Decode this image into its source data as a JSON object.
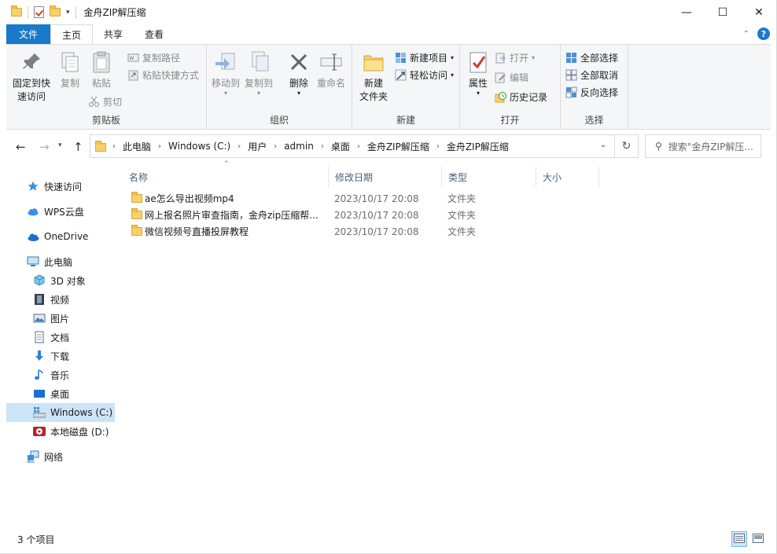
{
  "window": {
    "title": "金舟ZIP解压缩"
  },
  "window_controls": {
    "minimize": "—",
    "maximize": "☐",
    "close": "✕"
  },
  "ribbon_tabs": [
    {
      "label": "文件"
    },
    {
      "label": "主页"
    },
    {
      "label": "共享"
    },
    {
      "label": "查看"
    }
  ],
  "ribbon": {
    "clipboard": {
      "pin_line1": "固定到快",
      "pin_line2": "速访问",
      "copy": "复制",
      "paste": "粘贴",
      "copy_path": "复制路径",
      "paste_shortcut": "粘贴快捷方式",
      "cut": "剪切",
      "label": "剪贴板"
    },
    "organize": {
      "move_to": "移动到",
      "copy_to": "复制到",
      "delete": "删除",
      "rename": "重命名",
      "label": "组织"
    },
    "new": {
      "new_folder_line1": "新建",
      "new_folder_line2": "文件夹",
      "new_item": "新建项目",
      "easy_access": "轻松访问",
      "label": "新建"
    },
    "open": {
      "properties": "属性",
      "open": "打开",
      "edit": "编辑",
      "history": "历史记录",
      "label": "打开"
    },
    "select": {
      "select_all": "全部选择",
      "select_none": "全部取消",
      "invert": "反向选择",
      "label": "选择"
    }
  },
  "address": {
    "breadcrumbs": [
      "此电脑",
      "Windows (C:)",
      "用户",
      "admin",
      "桌面",
      "金舟ZIP解压缩",
      "金舟ZIP解压缩"
    ],
    "search_placeholder": "搜索\"金舟ZIP解压..."
  },
  "nav_pane": [
    {
      "label": "快速访问"
    },
    {
      "label": "WPS云盘"
    },
    {
      "label": "OneDrive"
    },
    {
      "label": "此电脑"
    },
    {
      "label": "3D 对象"
    },
    {
      "label": "视频"
    },
    {
      "label": "图片"
    },
    {
      "label": "文档"
    },
    {
      "label": "下载"
    },
    {
      "label": "音乐"
    },
    {
      "label": "桌面"
    },
    {
      "label": "Windows (C:)"
    },
    {
      "label": "本地磁盘 (D:)"
    },
    {
      "label": "网络"
    }
  ],
  "columns": {
    "name": "名称",
    "date": "修改日期",
    "type": "类型",
    "size": "大小"
  },
  "files": [
    {
      "name": "ae怎么导出视频mp4",
      "date": "2023/10/17 20:08",
      "type": "文件夹"
    },
    {
      "name": "网上报名照片审查指南，金舟zip压缩帮...",
      "date": "2023/10/17 20:08",
      "type": "文件夹"
    },
    {
      "name": "微信视频号直播投屏教程",
      "date": "2023/10/17 20:08",
      "type": "文件夹"
    }
  ],
  "status": {
    "count": "3 个项目"
  },
  "colors": {
    "accent": "#1979ca",
    "selection": "#cce4f7",
    "header_text": "#4c607a",
    "folder": "#f8d16b"
  }
}
